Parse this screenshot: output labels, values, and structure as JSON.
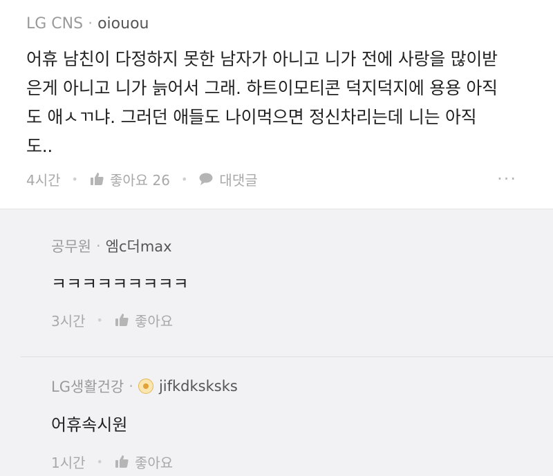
{
  "main_comment": {
    "company": "LG CNS",
    "nickname": "oiouou",
    "lines": [
      "어휴 남친이 다정하지 못한 남자가 아니고 니가 전에 사랑을 많이받",
      "은게 아니고 니가 늙어서 그래. 하트이모티콘 덕지덕지에 용용 아직",
      "도 애ㅅㄲ냐. 그러던 애들도 나이먹으면 정신차리는데 니는 아직",
      "도.."
    ],
    "time": "4시간",
    "like_label": "좋아요 26",
    "reply_label": "대댓글",
    "more_icon": "···"
  },
  "replies": [
    {
      "company": "공무원",
      "nickname": "엠c더max",
      "text": "ㅋㅋㅋㅋㅋㅋㅋㅋㅋ",
      "time": "3시간",
      "like_label": "좋아요"
    },
    {
      "company": "LG생활건강",
      "nickname": "jifkdksksks",
      "text": "어휴속시원",
      "time": "1시간",
      "like_label": "좋아요"
    }
  ],
  "colors": {
    "reply_background": "#f2f2f4",
    "muted_text": "#a8a8a8",
    "badge": "#e2a23a"
  },
  "icons": {
    "like": "thumbs-up-icon",
    "reply": "speech-bubble-icon",
    "more": "more-dots-icon",
    "badge": "flower-badge-icon"
  }
}
